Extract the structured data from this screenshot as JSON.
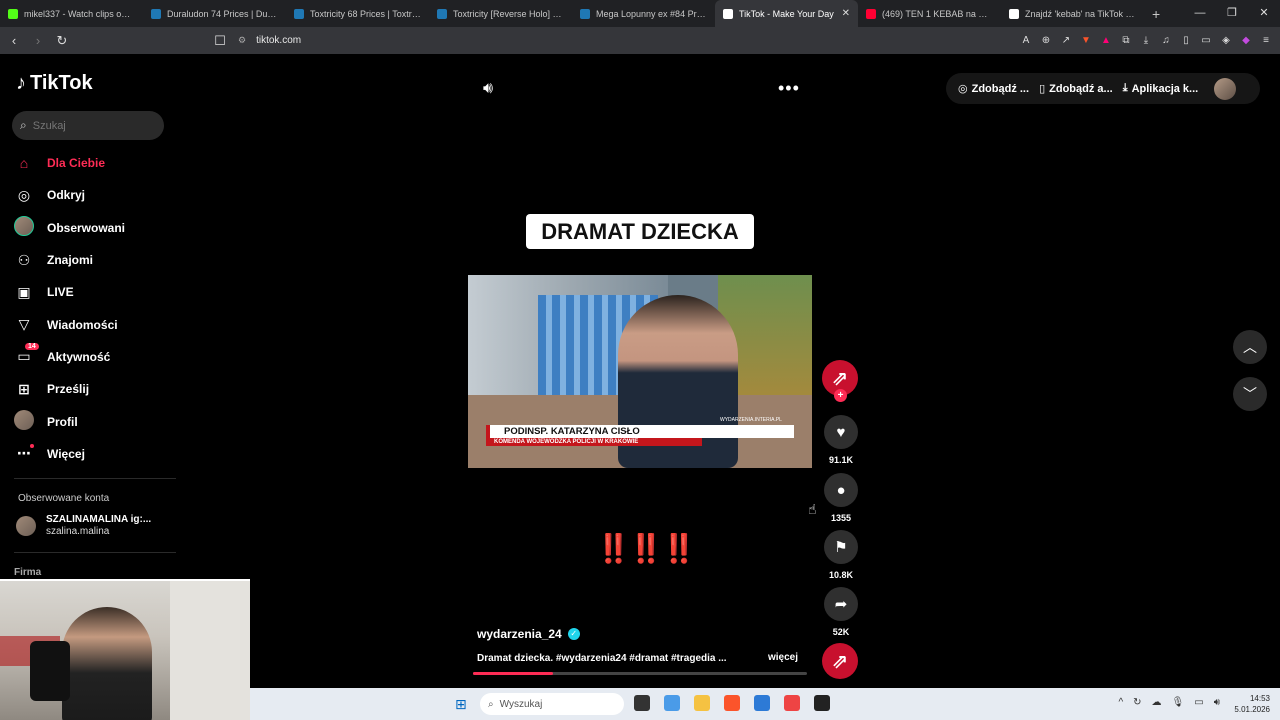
{
  "browser": {
    "tabs": [
      {
        "title": "mikel337 - Watch clips on Kick",
        "color": "#53fc18"
      },
      {
        "title": "Duraludon 74 Prices | Duraludo",
        "color": "#1f78b4"
      },
      {
        "title": "Toxtricity 68 Prices | Toxtricity",
        "color": "#1f78b4"
      },
      {
        "title": "Toxtricity [Reverse Holo] #68 P",
        "color": "#1f78b4"
      },
      {
        "title": "Mega Lopunny ex #84 Prices |",
        "color": "#1f78b4"
      },
      {
        "title": "TikTok - Make Your Day",
        "color": "#ffffff"
      },
      {
        "title": "(469) TEN 1 KEBAB na CAŁE ŻY",
        "color": "#ff0033"
      },
      {
        "title": "Znajdź 'kebab' na TikTok | Wys",
        "color": "#ffffff"
      }
    ],
    "active_tab_index": 5,
    "url": "tiktok.com"
  },
  "sidebar": {
    "logo": "TikTok",
    "search_placeholder": "Szukaj",
    "items": [
      {
        "label": "Dla Ciebie",
        "icon": "home-icon"
      },
      {
        "label": "Odkryj",
        "icon": "compass-icon"
      },
      {
        "label": "Obserwowani",
        "icon": "avatar-icon"
      },
      {
        "label": "Znajomi",
        "icon": "friends-icon"
      },
      {
        "label": "LIVE",
        "icon": "live-icon"
      },
      {
        "label": "Wiadomości",
        "icon": "send-icon"
      },
      {
        "label": "Aktywność",
        "icon": "inbox-icon",
        "badge": "14"
      },
      {
        "label": "Prześlij",
        "icon": "upload-icon"
      },
      {
        "label": "Profil",
        "icon": "profile-avatar-icon"
      },
      {
        "label": "Więcej",
        "icon": "more-dots-icon"
      }
    ],
    "followed_title": "Obserwowane konta",
    "followed": [
      {
        "name": "SZALINAMALINA ig:...",
        "handle": "szalina.malina"
      }
    ],
    "firma": "Firma"
  },
  "header": {
    "buttons": [
      "Zdobądź ...",
      "Zdobądź a...",
      "Aplikacja k..."
    ]
  },
  "video": {
    "overlay_title": "DRAMAT DZIECKA",
    "chyron_name": "PODINSP. KATARZYNA CISŁO",
    "chyron_org": "KOMENDA WOJEWÓDZKA POLICJI W KRAKOWIE",
    "brand": "WYDARZENIA.INTERIA.PL",
    "exclamations": "‼️‼️‼️",
    "author": "wydarzenia_24",
    "caption": "Dramat dziecka. #wydarzenia24 #dramat #tragedia ...",
    "more": "więcej",
    "progress": 0.24
  },
  "actions": {
    "likes": "91.1K",
    "comments": "1355",
    "saves": "10.8K",
    "shares": "52K"
  },
  "taskbar": {
    "search_placeholder": "Wyszukaj",
    "time": "14:53",
    "date": "5.01.2026"
  }
}
